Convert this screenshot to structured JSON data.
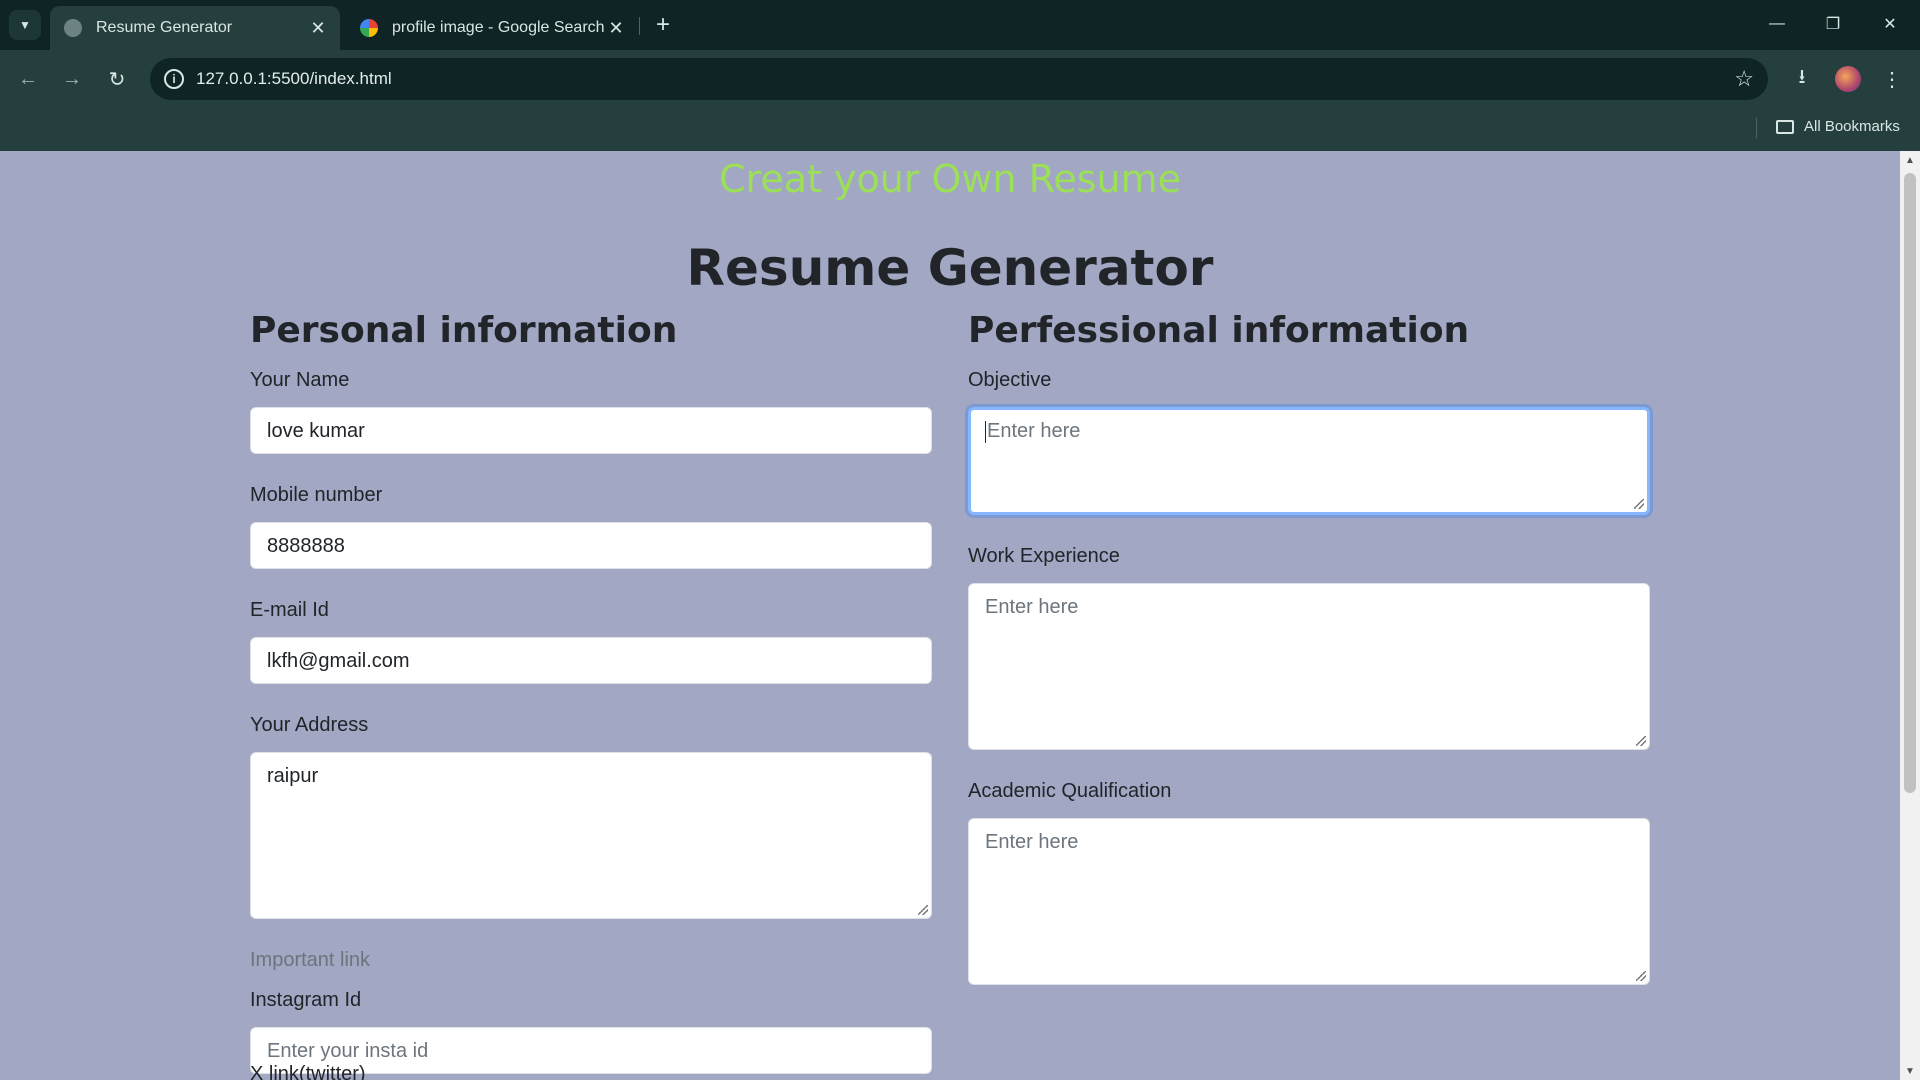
{
  "browser": {
    "tabs": [
      {
        "title": "Resume Generator",
        "active": true
      },
      {
        "title": "profile image - Google Search",
        "active": false
      }
    ],
    "url": "127.0.0.1:5500/index.html",
    "bookmarks_label": "All Bookmarks"
  },
  "page": {
    "tagline": "Creat your Own Resume",
    "title": "Resume Generator",
    "personal": {
      "heading": "Personal information",
      "name_label": "Your Name",
      "name_value": "love kumar",
      "mobile_label": "Mobile number",
      "mobile_value": "8888888",
      "email_label": "E-mail Id",
      "email_value": "lkfh@gmail.com",
      "address_label": "Your Address",
      "address_value": "raipur",
      "links_heading": "Important link",
      "instagram_label": "Instagram Id",
      "instagram_placeholder": "Enter your insta id",
      "twitter_label": "X link(twitter)"
    },
    "professional": {
      "heading": "Perfessional information",
      "objective_label": "Objective",
      "objective_placeholder": "Enter here",
      "work_label": "Work Experience",
      "work_placeholder": "Enter here",
      "academic_label": "Academic Qualification",
      "academic_placeholder": "Enter here"
    }
  },
  "colors": {
    "page_bg": "#a2a7c3",
    "tagline": "#9be056",
    "focus_ring": "#86b7fe"
  }
}
